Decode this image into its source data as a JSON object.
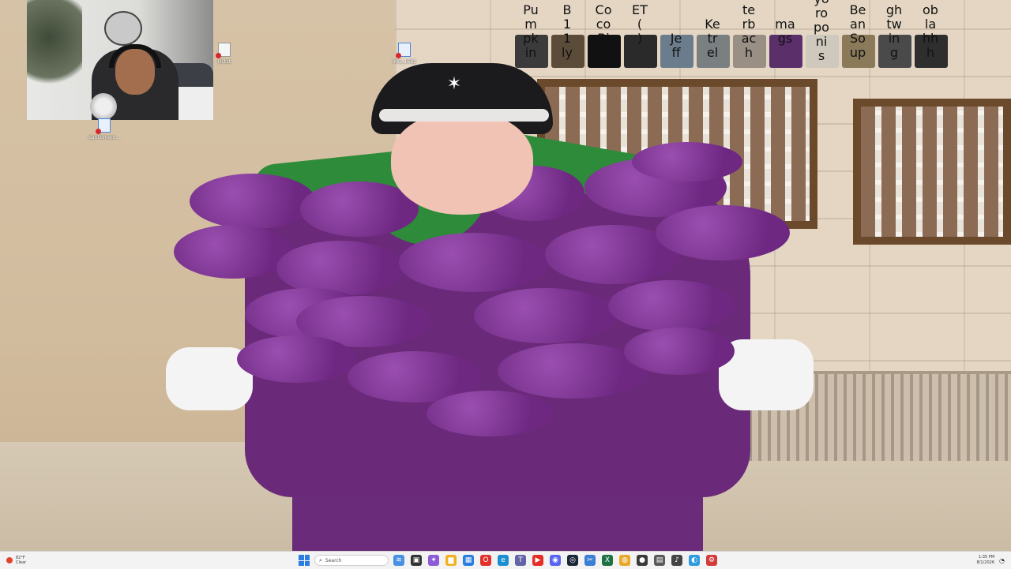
{
  "desktop": {
    "icons": [
      {
        "label": "Hi.txt"
      },
      {
        "label": "IMG_1682"
      },
      {
        "label": "darillomero..."
      }
    ]
  },
  "contacts": [
    {
      "name": "Pu\nm\npk\nin",
      "color": "#3b3b3b"
    },
    {
      "name": "B\n1\n1\nly",
      "color": "#5b4c3a"
    },
    {
      "name": "Co\nco\nBi\nsh",
      "color": "#111111"
    },
    {
      "name": "ET\n(\n)",
      "color": "#2a2a2a"
    },
    {
      "name": "Je\nff",
      "color": "#6b7d8c"
    },
    {
      "name": "Ke\ntr\nel",
      "color": "#7a7f82"
    },
    {
      "name": "te\nrb\nac\nh",
      "color": "#9a8f84"
    },
    {
      "name": "ma\ngs",
      "color": "#5a2f6a"
    },
    {
      "name": "yo\nro\npo\nni\ns",
      "color": "#cfc8bd"
    },
    {
      "name": "Be\nan\nSo\nup",
      "color": "#8a7a5a"
    },
    {
      "name": "gh\ntw\nin\ng",
      "color": "#4a4a4a"
    },
    {
      "name": "ob\nla\nhh\nh",
      "color": "#2e2e2e"
    }
  ],
  "taskbar": {
    "weather_temp": "82°F",
    "weather_desc": "Clear",
    "search_placeholder": "Search",
    "pinned_icons": [
      {
        "name": "widgets-icon",
        "glyph": "≋",
        "color": "#4a90e2"
      },
      {
        "name": "task-view-icon",
        "glyph": "▣",
        "color": "#333333"
      },
      {
        "name": "copilot-icon",
        "glyph": "✦",
        "color": "#8e5bd8"
      },
      {
        "name": "file-explorer-icon",
        "glyph": "▆",
        "color": "#f2b01e"
      },
      {
        "name": "store-icon",
        "glyph": "▦",
        "color": "#2a7de1"
      },
      {
        "name": "opera-icon",
        "glyph": "O",
        "color": "#e0312b"
      },
      {
        "name": "edge-icon",
        "glyph": "e",
        "color": "#1c8fd1"
      },
      {
        "name": "teams-icon",
        "glyph": "T",
        "color": "#6264a7"
      },
      {
        "name": "youtube-icon",
        "glyph": "▶",
        "color": "#e52d27"
      },
      {
        "name": "discord-icon",
        "glyph": "◉",
        "color": "#5865f2"
      },
      {
        "name": "steam-icon",
        "glyph": "◎",
        "color": "#1b2838"
      },
      {
        "name": "snipping-tool-icon",
        "glyph": "✂",
        "color": "#3c7fd6"
      },
      {
        "name": "excel-icon",
        "glyph": "X",
        "color": "#1e7145"
      },
      {
        "name": "chrome-icon",
        "glyph": "◍",
        "color": "#e8a92b"
      },
      {
        "name": "obs-icon",
        "glyph": "●",
        "color": "#3a3a3a"
      },
      {
        "name": "calculator-icon",
        "glyph": "▤",
        "color": "#5a5a5a"
      },
      {
        "name": "music-icon",
        "glyph": "♪",
        "color": "#444444"
      },
      {
        "name": "paint-icon",
        "glyph": "◐",
        "color": "#2c9be0"
      },
      {
        "name": "settings-icon",
        "glyph": "⚙",
        "color": "#d33c3c"
      }
    ],
    "time": "1:35 PM",
    "date": "8/1/2026"
  }
}
